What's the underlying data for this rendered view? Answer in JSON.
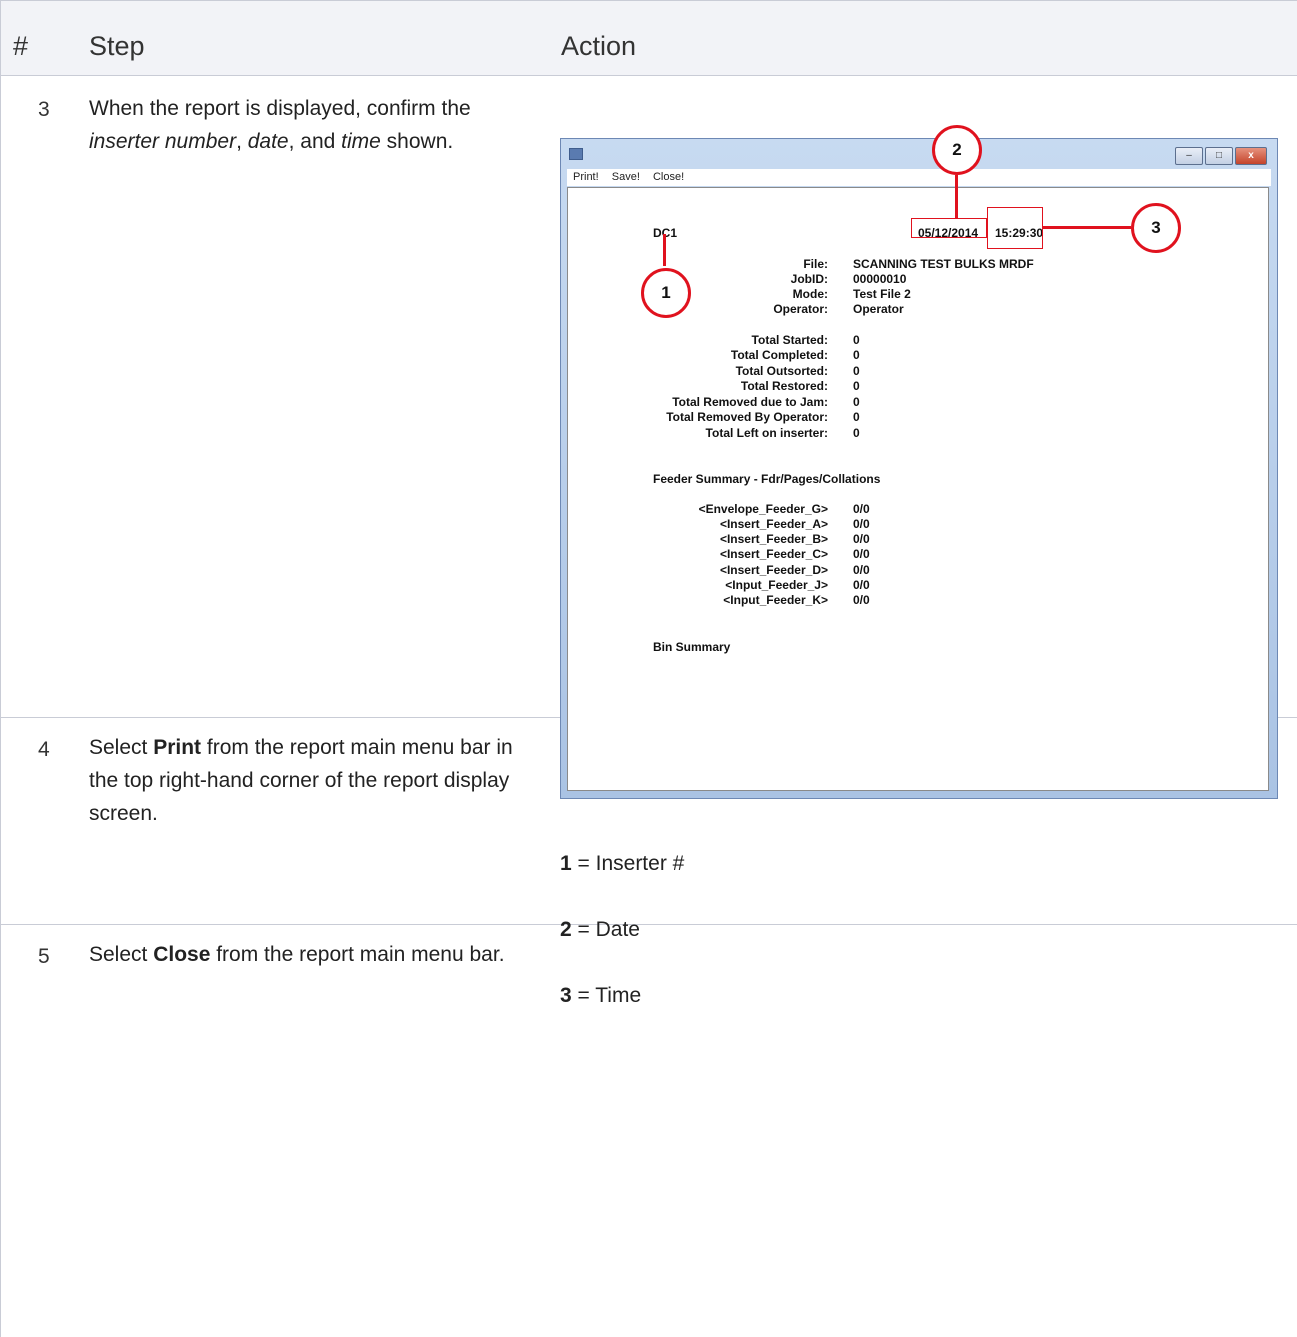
{
  "header": {
    "num": "#",
    "step": "Step",
    "action": "Action"
  },
  "rows": [
    {
      "num": "3",
      "step_parts": [
        "When the report is displayed, confirm the",
        "inserter number",
        ", ",
        "date",
        ", and ",
        "time",
        " shown."
      ]
    },
    {
      "num": "4",
      "step_parts": [
        "Select ",
        "Print",
        " from the report main menu bar in the top right-hand corner of the report display screen."
      ]
    },
    {
      "num": "5",
      "step_parts": [
        "Select ",
        "Close",
        " from the report main menu bar."
      ]
    }
  ],
  "report_window": {
    "menu": [
      "Print!",
      "Save!",
      "Close!"
    ],
    "window_buttons": [
      "–",
      "□",
      "x"
    ],
    "inserter": "DC1",
    "date": "05/12/2014",
    "time": "15:29:30",
    "info": [
      {
        "label": "File:",
        "value": "SCANNING TEST BULKS MRDF"
      },
      {
        "label": "JobID:",
        "value": "00000010"
      },
      {
        "label": "Mode:",
        "value": "Test File 2"
      },
      {
        "label": "Operator:",
        "value": "Operator"
      }
    ],
    "totals": [
      {
        "label": "Total Started:",
        "value": "0"
      },
      {
        "label": "Total Completed:",
        "value": "0"
      },
      {
        "label": "Total Outsorted:",
        "value": "0"
      },
      {
        "label": "Total Restored:",
        "value": "0"
      },
      {
        "label": "Total Removed due to Jam:",
        "value": "0"
      },
      {
        "label": "Total Removed By Operator:",
        "value": "0"
      },
      {
        "label": "Total Left on inserter:",
        "value": "0"
      }
    ],
    "feeder_title": "Feeder Summary - Fdr/Pages/Collations",
    "feeders": [
      {
        "label": "<Envelope_Feeder_G>",
        "value": "0/0"
      },
      {
        "label": "<Insert_Feeder_A>",
        "value": "0/0"
      },
      {
        "label": "<Insert_Feeder_B>",
        "value": "0/0"
      },
      {
        "label": "<Insert_Feeder_C>",
        "value": "0/0"
      },
      {
        "label": "<Insert_Feeder_D>",
        "value": "0/0"
      },
      {
        "label": "<Input_Feeder_J>",
        "value": "0/0"
      },
      {
        "label": "<Input_Feeder_K>",
        "value": "0/0"
      }
    ],
    "bin_title": "Bin Summary"
  },
  "callouts": [
    "1",
    "2",
    "3"
  ],
  "legend": [
    {
      "num": "1",
      "text": " = Inserter #"
    },
    {
      "num": "2",
      "text": " = Date"
    },
    {
      "num": "3",
      "text": " = Time"
    }
  ],
  "colors": {
    "callout_red": "#e0121e",
    "header_bg": "#f2f3f7",
    "border": "#c9ccd6"
  }
}
